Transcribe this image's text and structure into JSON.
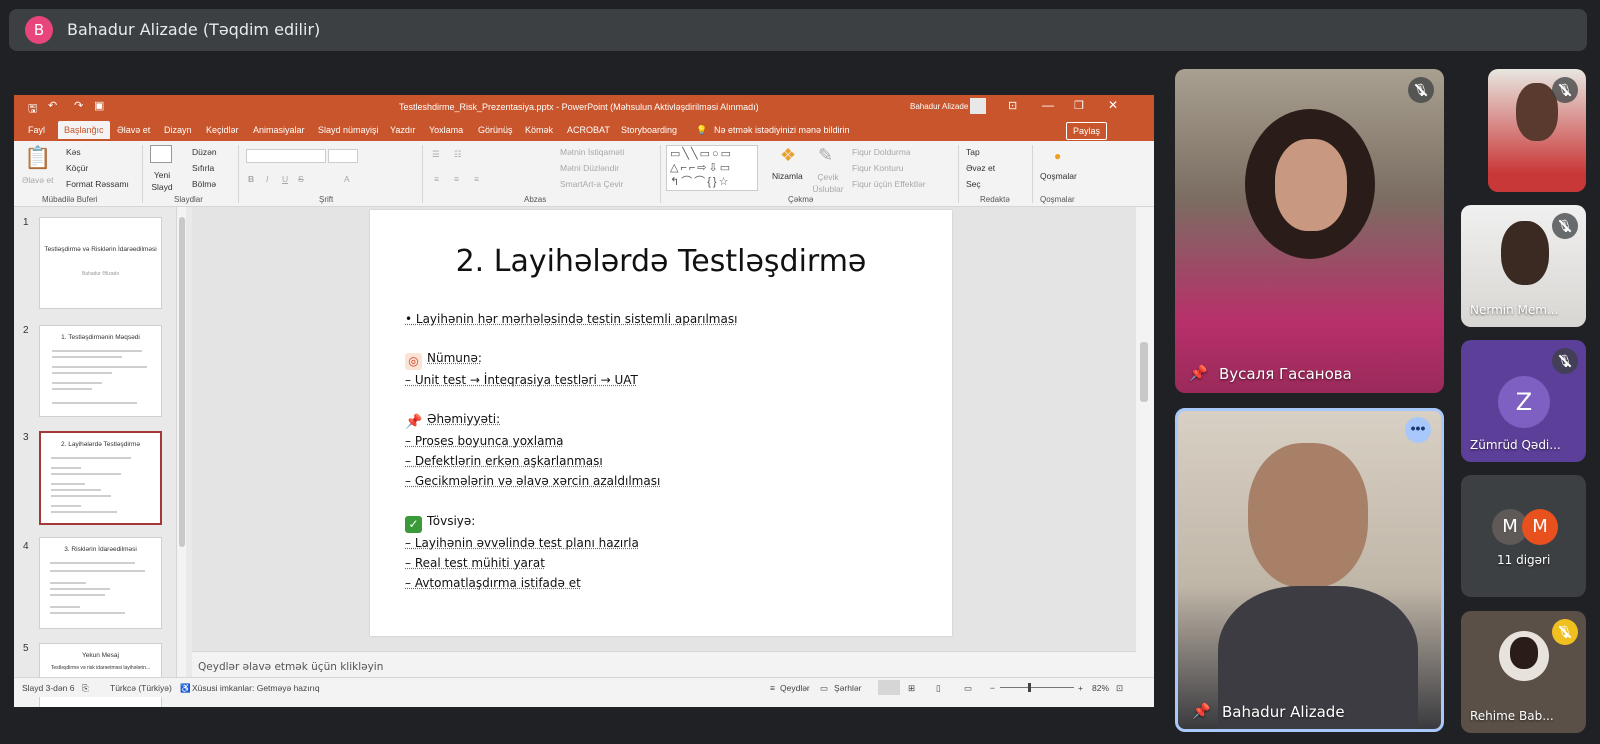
{
  "presenter": {
    "initial": "B",
    "title": "Bahadur Alizade (Təqdim edilir)"
  },
  "ppt": {
    "window_title": "Testleshdirme_Risk_Prezentasiya.pptx  -  PowerPoint (Məhsulun Aktivləşdirilməsi Alınmadı)",
    "user": "Bahadur Alizade",
    "tabs": [
      "Fayl",
      "Başlanğıc",
      "Əlavə et",
      "Dizayn",
      "Keçidlər",
      "Animasiyalar",
      "Slayd nümayişi",
      "Yazdır",
      "Yoxlama",
      "Görünüş",
      "Kömək",
      "ACROBAT",
      "Storyboarding"
    ],
    "tell_me": "Nə etmək istədiyinizi mənə bildirin",
    "share": "Paylaş",
    "ribbon": {
      "paste": "Əlavə et",
      "cut": "Kəs",
      "copy": "Köçür",
      "format_painter": "Format Rəssamı",
      "group_clipboard": "Mübadilə Buferi",
      "new_slide": "Yeni Slayd",
      "layout": "Düzən",
      "reset": "Sıfırla",
      "section": "Bölmə",
      "group_slides": "Slaydlar",
      "group_font": "Şrift",
      "align_text": "Mətnin İstiqaməti",
      "align": "Mətni Düzləndir",
      "smartart": "SmartArt-a Çevir",
      "group_paragraph": "Abzas",
      "arrange": "Nizamla",
      "quick_styles": "Çevik Üslublar",
      "shape_fill": "Fiqur Doldurma",
      "shape_outline": "Fiqur Konturu",
      "shape_effects": "Fiqur üçün Effektlər",
      "group_drawing": "Çəkmə",
      "find": "Tap",
      "replace": "Əvəz et",
      "select": "Seç",
      "group_editing": "Redaktə",
      "addins": "Qoşmalar",
      "group_addins": "Qoşmalar"
    },
    "thumbs": [
      {
        "num": "1",
        "title": "Testləşdirmə və Risklərin İdarəedilməsi",
        "sub": "Bahadur Əlizadə"
      },
      {
        "num": "2",
        "title": "1. Testləşdirmənin Məqsədi"
      },
      {
        "num": "3",
        "title": "2. Layihələrdə Testləşdirmə"
      },
      {
        "num": "4",
        "title": "3. Risklərin İdarəedilməsi"
      },
      {
        "num": "5",
        "title": "Yekun Mesaj",
        "sub": "Testləşdirmə və risk idarəetməsi layihələrin..."
      }
    ],
    "slide": {
      "title": "2. Layihələrdə Testləşdirmə",
      "bullet": "• Layihənin hər mərhələsində testin sistemli aparılması",
      "example_head": "Nümunə:",
      "example_line": "– Unit test → İnteqrasiya testləri → UAT",
      "importance_head": "Əhəmiyyəti:",
      "importance_lines": [
        "– Proses boyunca yoxlama",
        "– Defektlərin erkən aşkarlanması",
        "– Gecikmələrin və əlavə xərcin azaldılması"
      ],
      "advice_head": "Tövsiyə:",
      "advice_lines": [
        "– Layihənin əvvəlində test planı hazırla",
        "– Real test mühiti yarat",
        "– Avtomatlaşdırma istifadə et"
      ]
    },
    "notes_placeholder": "Qeydlər əlavə etmək üçün klikləyin",
    "status": {
      "slide": "Slayd 3-dən 6",
      "language": "Türkcə (Türkiyə)",
      "accessibility": "Xüsusi imkanlar: Getməyə hazırıq",
      "notes": "Qeydlər",
      "comments": "Şərhlər",
      "zoom": "82%"
    }
  },
  "participants": {
    "vusala": "Вусаля Гасанова",
    "bahadur": "Bahadur Alizade",
    "nermin": "Nermin Mem...",
    "zumrud_initial": "Z",
    "zumrud": "Zümrüd Qədi...",
    "others_a": "M",
    "others_b": "M",
    "others_label": "11 digəri",
    "rehime": "Rehime Bab..."
  },
  "colors": {
    "accent_ppt": "#c8552c",
    "meet_bg": "#202124",
    "active_speaker": "#a8c7fa"
  }
}
